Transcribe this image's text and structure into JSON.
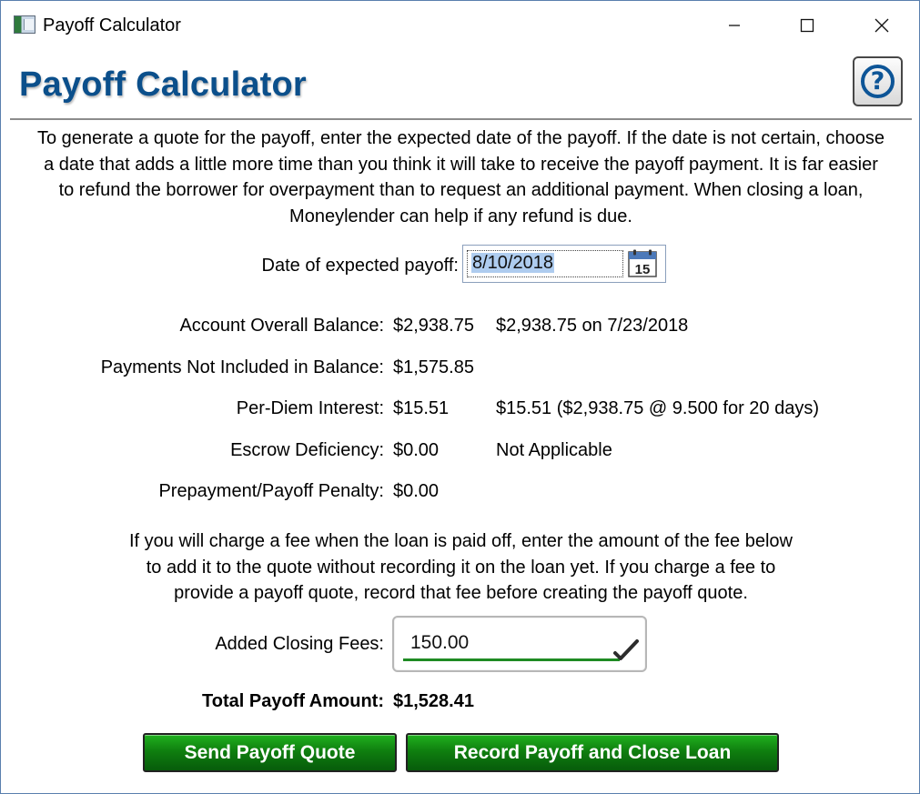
{
  "window": {
    "title": "Payoff Calculator",
    "icon": "payoff-calculator-app-icon",
    "controls": [
      "minimize-icon",
      "maximize-icon",
      "close-icon"
    ]
  },
  "header": {
    "title": "Payoff Calculator",
    "help_icon": "question-mark-icon",
    "help_symbol": "?"
  },
  "intro": {
    "line_1": "To generate a quote for the payoff, enter the expected date of the payoff. If the date is not certain, choose",
    "line_2": "a date that adds a little more time than you think it will take to receive the payoff payment. It is far easier",
    "line_3": "to refund the borrower for overpayment than to request an additional payment. When closing a loan,",
    "line_4": "Moneylender can help if any refund is due."
  },
  "payoff_date": {
    "label": "Date of expected payoff:",
    "value": "8/10/2018",
    "calendar_icon": "calendar-icon",
    "calendar_day": "15"
  },
  "summary": [
    {
      "label": "Account Overall Balance:",
      "value": "$2,938.75",
      "detail": "$2,938.75 on 7/23/2018"
    },
    {
      "label": "Payments Not Included in Balance:",
      "value": "$1,575.85",
      "detail": ""
    },
    {
      "label": "Per-Diem Interest:",
      "value": "$15.51",
      "detail": "$15.51 ($2,938.75 @ 9.500 for 20 days)"
    },
    {
      "label": "Escrow Deficiency:",
      "value": "$0.00",
      "detail": "Not Applicable"
    },
    {
      "label": "Prepayment/Payoff Penalty:",
      "value": "$0.00",
      "detail": ""
    }
  ],
  "fee_note": {
    "line_1": "If you will charge a fee when the loan is paid off, enter the amount of the fee below",
    "line_2": "to add it to the quote without recording it on the loan yet. If you charge a fee to",
    "line_3": "provide a payoff quote, record that fee before creating the payoff quote."
  },
  "closing_fees": {
    "label": "Added Closing Fees:",
    "value": "150.00",
    "valid_icon": "checkmark-icon",
    "accent_color": "#1f8b24"
  },
  "total": {
    "label": "Total Payoff Amount:",
    "value": "$1,528.41"
  },
  "actions": {
    "send_label": "Send Payoff Quote",
    "record_label": "Record Payoff and Close Loan",
    "button_color": "#0f7f0f"
  },
  "colors": {
    "title_blue": "#0b4f8b",
    "window_border": "#5a7fae",
    "selection_blue": "#aeccef"
  }
}
